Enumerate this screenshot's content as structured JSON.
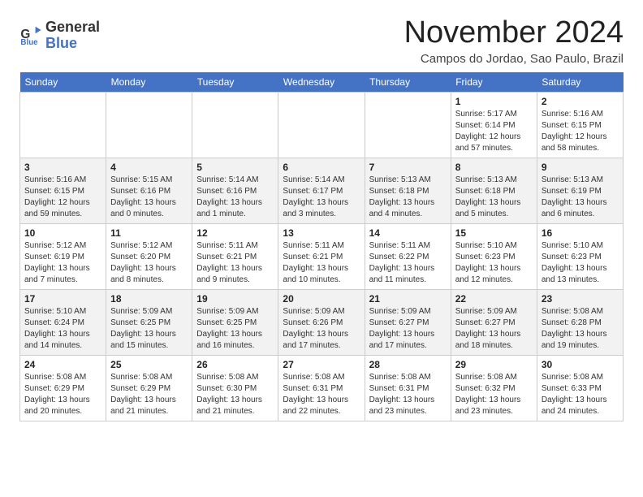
{
  "logo": {
    "line1": "General",
    "line2": "Blue"
  },
  "title": "November 2024",
  "location": "Campos do Jordao, Sao Paulo, Brazil",
  "weekdays": [
    "Sunday",
    "Monday",
    "Tuesday",
    "Wednesday",
    "Thursday",
    "Friday",
    "Saturday"
  ],
  "weeks": [
    [
      {
        "day": "",
        "info": ""
      },
      {
        "day": "",
        "info": ""
      },
      {
        "day": "",
        "info": ""
      },
      {
        "day": "",
        "info": ""
      },
      {
        "day": "",
        "info": ""
      },
      {
        "day": "1",
        "info": "Sunrise: 5:17 AM\nSunset: 6:14 PM\nDaylight: 12 hours\nand 57 minutes."
      },
      {
        "day": "2",
        "info": "Sunrise: 5:16 AM\nSunset: 6:15 PM\nDaylight: 12 hours\nand 58 minutes."
      }
    ],
    [
      {
        "day": "3",
        "info": "Sunrise: 5:16 AM\nSunset: 6:15 PM\nDaylight: 12 hours\nand 59 minutes."
      },
      {
        "day": "4",
        "info": "Sunrise: 5:15 AM\nSunset: 6:16 PM\nDaylight: 13 hours\nand 0 minutes."
      },
      {
        "day": "5",
        "info": "Sunrise: 5:14 AM\nSunset: 6:16 PM\nDaylight: 13 hours\nand 1 minute."
      },
      {
        "day": "6",
        "info": "Sunrise: 5:14 AM\nSunset: 6:17 PM\nDaylight: 13 hours\nand 3 minutes."
      },
      {
        "day": "7",
        "info": "Sunrise: 5:13 AM\nSunset: 6:18 PM\nDaylight: 13 hours\nand 4 minutes."
      },
      {
        "day": "8",
        "info": "Sunrise: 5:13 AM\nSunset: 6:18 PM\nDaylight: 13 hours\nand 5 minutes."
      },
      {
        "day": "9",
        "info": "Sunrise: 5:13 AM\nSunset: 6:19 PM\nDaylight: 13 hours\nand 6 minutes."
      }
    ],
    [
      {
        "day": "10",
        "info": "Sunrise: 5:12 AM\nSunset: 6:19 PM\nDaylight: 13 hours\nand 7 minutes."
      },
      {
        "day": "11",
        "info": "Sunrise: 5:12 AM\nSunset: 6:20 PM\nDaylight: 13 hours\nand 8 minutes."
      },
      {
        "day": "12",
        "info": "Sunrise: 5:11 AM\nSunset: 6:21 PM\nDaylight: 13 hours\nand 9 minutes."
      },
      {
        "day": "13",
        "info": "Sunrise: 5:11 AM\nSunset: 6:21 PM\nDaylight: 13 hours\nand 10 minutes."
      },
      {
        "day": "14",
        "info": "Sunrise: 5:11 AM\nSunset: 6:22 PM\nDaylight: 13 hours\nand 11 minutes."
      },
      {
        "day": "15",
        "info": "Sunrise: 5:10 AM\nSunset: 6:23 PM\nDaylight: 13 hours\nand 12 minutes."
      },
      {
        "day": "16",
        "info": "Sunrise: 5:10 AM\nSunset: 6:23 PM\nDaylight: 13 hours\nand 13 minutes."
      }
    ],
    [
      {
        "day": "17",
        "info": "Sunrise: 5:10 AM\nSunset: 6:24 PM\nDaylight: 13 hours\nand 14 minutes."
      },
      {
        "day": "18",
        "info": "Sunrise: 5:09 AM\nSunset: 6:25 PM\nDaylight: 13 hours\nand 15 minutes."
      },
      {
        "day": "19",
        "info": "Sunrise: 5:09 AM\nSunset: 6:25 PM\nDaylight: 13 hours\nand 16 minutes."
      },
      {
        "day": "20",
        "info": "Sunrise: 5:09 AM\nSunset: 6:26 PM\nDaylight: 13 hours\nand 17 minutes."
      },
      {
        "day": "21",
        "info": "Sunrise: 5:09 AM\nSunset: 6:27 PM\nDaylight: 13 hours\nand 17 minutes."
      },
      {
        "day": "22",
        "info": "Sunrise: 5:09 AM\nSunset: 6:27 PM\nDaylight: 13 hours\nand 18 minutes."
      },
      {
        "day": "23",
        "info": "Sunrise: 5:08 AM\nSunset: 6:28 PM\nDaylight: 13 hours\nand 19 minutes."
      }
    ],
    [
      {
        "day": "24",
        "info": "Sunrise: 5:08 AM\nSunset: 6:29 PM\nDaylight: 13 hours\nand 20 minutes."
      },
      {
        "day": "25",
        "info": "Sunrise: 5:08 AM\nSunset: 6:29 PM\nDaylight: 13 hours\nand 21 minutes."
      },
      {
        "day": "26",
        "info": "Sunrise: 5:08 AM\nSunset: 6:30 PM\nDaylight: 13 hours\nand 21 minutes."
      },
      {
        "day": "27",
        "info": "Sunrise: 5:08 AM\nSunset: 6:31 PM\nDaylight: 13 hours\nand 22 minutes."
      },
      {
        "day": "28",
        "info": "Sunrise: 5:08 AM\nSunset: 6:31 PM\nDaylight: 13 hours\nand 23 minutes."
      },
      {
        "day": "29",
        "info": "Sunrise: 5:08 AM\nSunset: 6:32 PM\nDaylight: 13 hours\nand 23 minutes."
      },
      {
        "day": "30",
        "info": "Sunrise: 5:08 AM\nSunset: 6:33 PM\nDaylight: 13 hours\nand 24 minutes."
      }
    ]
  ]
}
